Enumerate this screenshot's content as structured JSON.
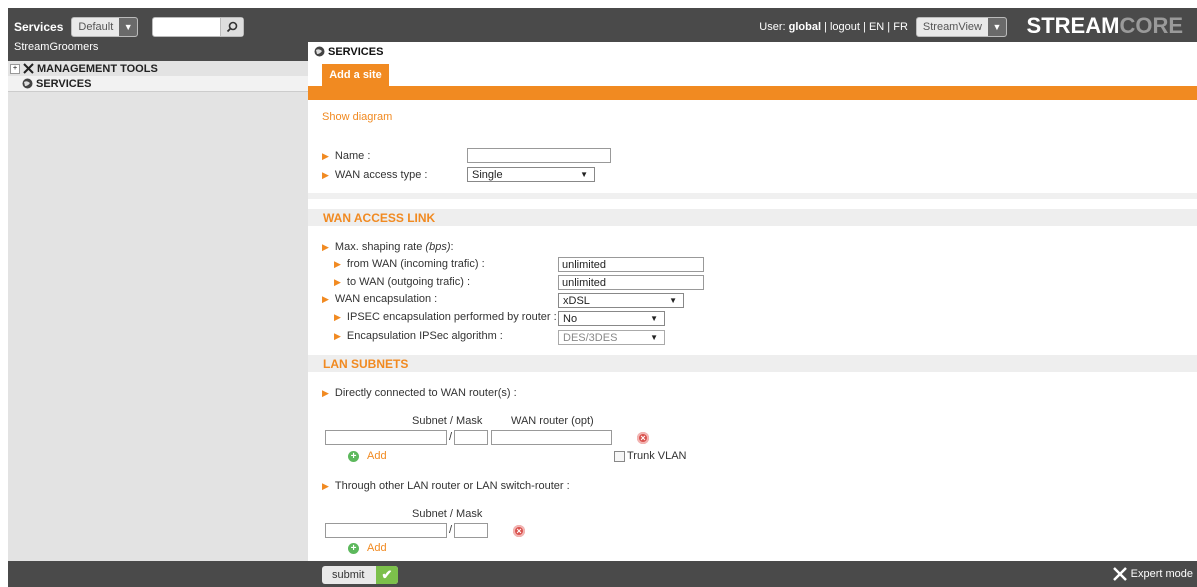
{
  "topbar": {
    "app_label": "Services",
    "profile_select": "Default",
    "search_value": "",
    "sub_brand": "StreamGroomers",
    "user_prefix": "User:",
    "user_name": "global",
    "logout_link": "logout",
    "lang_en": "EN",
    "lang_fr": "FR",
    "view_select": "StreamView",
    "logo_main": "STREAM",
    "logo_accent": "CORE"
  },
  "sidebar": {
    "items": [
      {
        "label": "MANAGEMENT TOOLS",
        "icon": "tools-icon"
      },
      {
        "label": "SERVICES",
        "icon": "globe-icon"
      }
    ]
  },
  "main": {
    "tab_title": "SERVICES",
    "subtab": "Add a site",
    "show_diagram": "Show diagram",
    "name_label": "Name :",
    "name_value": "",
    "wan_access_type_label": "WAN access type :",
    "wan_access_type_value": "Single"
  },
  "wan_link": {
    "title": "WAN ACCESS LINK",
    "max_shaping_label": "Max. shaping rate",
    "max_shaping_unit": "(bps)",
    "max_shaping_colon": " :",
    "from_wan_label": "from WAN (incoming trafic) :",
    "from_wan_value": "unlimited",
    "to_wan_label": "to WAN (outgoing trafic) :",
    "to_wan_value": "unlimited",
    "encap_label": "WAN encapsulation :",
    "encap_value": "xDSL",
    "ipsec_label": "IPSEC encapsulation performed by router :",
    "ipsec_value": "No",
    "ipsec_algo_label": "Encapsulation IPSec algorithm :",
    "ipsec_algo_value": "DES/3DES"
  },
  "lan": {
    "title": "LAN SUBNETS",
    "direct_label": "Directly connected to WAN router(s) :",
    "subnet_mask_header": "Subnet / Mask",
    "wan_router_header": "WAN router (opt)",
    "slash": "/",
    "add_label": "Add",
    "trunk_vlan": "Trunk VLAN",
    "through_label": "Through other LAN router or LAN switch-router :",
    "subnet_mask_header2": "Subnet / Mask",
    "add_label2": "Add"
  },
  "footer": {
    "submit": "submit",
    "expert_mode": "Expert mode"
  }
}
